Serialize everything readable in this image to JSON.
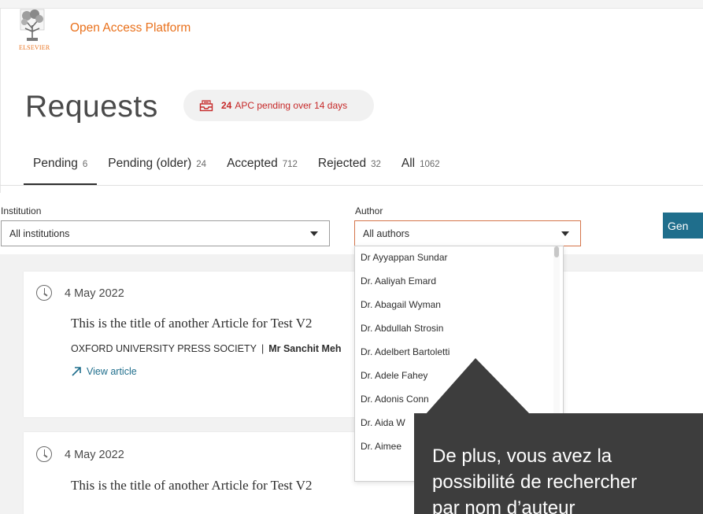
{
  "brand": {
    "logo_text": "ELSEVIER",
    "name": "Open Access Platform"
  },
  "header": {
    "title": "Requests",
    "badge_count": "24",
    "badge_text": "APC pending over 14 days"
  },
  "tabs": [
    {
      "label": "Pending",
      "count": "6"
    },
    {
      "label": "Pending (older)",
      "count": "24"
    },
    {
      "label": "Accepted",
      "count": "712"
    },
    {
      "label": "Rejected",
      "count": "32"
    },
    {
      "label": "All",
      "count": "1062"
    }
  ],
  "filters": {
    "institution_label": "Institution",
    "institution_value": "All institutions",
    "author_label": "Author",
    "author_value": "All authors",
    "generate_label": "Gen"
  },
  "author_options": [
    "Dr Ayyappan Sundar",
    "Dr. Aaliyah Emard",
    "Dr. Abagail Wyman",
    "Dr. Abdullah Strosin",
    "Dr. Adelbert Bartoletti",
    "Dr. Adele Fahey",
    "Dr. Adonis Conn",
    "Dr. Aida W",
    "Dr. Aimee"
  ],
  "requests": [
    {
      "date": "4 May 2022",
      "title": "This is the title of another Article for Test V2",
      "publisher": "OXFORD UNIVERSITY PRESS SOCIETY",
      "person": "Mr Sanchit Meh",
      "link": "View article"
    },
    {
      "date": "4 May 2022",
      "title": "This is the title of another Article for Test V2"
    }
  ],
  "tooltip": {
    "line1": "De plus, vous avez la",
    "line2": "possibilité de rechercher",
    "line3": "par nom d’auteur"
  },
  "colors": {
    "brand_orange": "#e9711c",
    "alert_red": "#c62828",
    "link_blue": "#1f6e8c",
    "tooltip_bg": "#3d3d3d"
  }
}
